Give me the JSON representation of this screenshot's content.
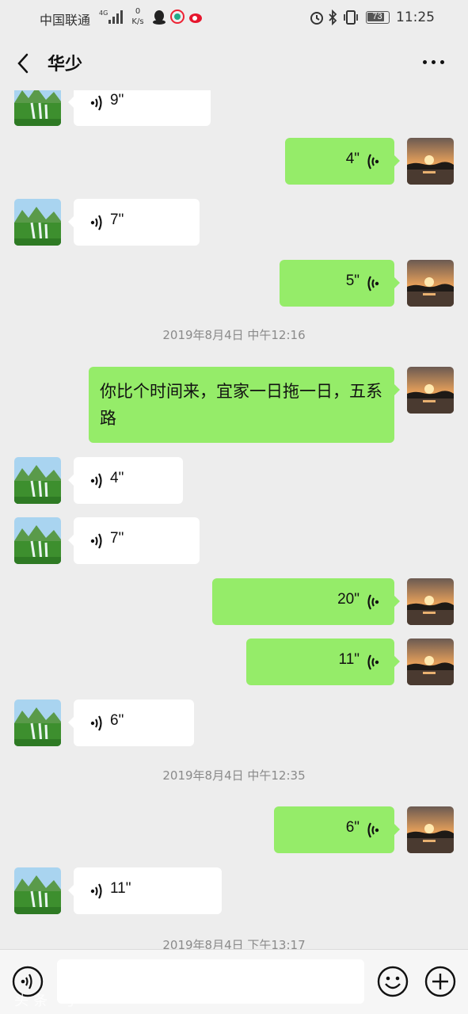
{
  "status_bar": {
    "carrier": "中国联通",
    "network": "4G",
    "speed_value": "0",
    "speed_unit": "K/s",
    "battery": "73",
    "time": "11:25"
  },
  "header": {
    "title": "华少"
  },
  "messages": [
    {
      "side": "in",
      "duration": "9\""
    },
    {
      "side": "out",
      "duration": "4\""
    },
    {
      "side": "in",
      "duration": "7\""
    },
    {
      "side": "out",
      "duration": "5\""
    },
    {
      "timestamp": "2019年8月4日 中午12:16"
    },
    {
      "side": "out",
      "text": "你比个时间来，宜家一日拖一日，五系路"
    },
    {
      "side": "in",
      "duration": "4\""
    },
    {
      "side": "in",
      "duration": "7\""
    },
    {
      "side": "out",
      "duration": "20\""
    },
    {
      "side": "out",
      "duration": "11\""
    },
    {
      "side": "in",
      "duration": "6\""
    },
    {
      "timestamp": "2019年8月4日 中午12:35"
    },
    {
      "side": "out",
      "duration": "6\""
    },
    {
      "side": "in",
      "duration": "11\""
    },
    {
      "timestamp": "2019年8月4日 下午13:17"
    }
  ],
  "input_bar": {
    "message_value": "",
    "watermark": "头条 号"
  },
  "colors": {
    "background": "#ededed",
    "outgoing_bubble": "#95ec69",
    "incoming_bubble": "#ffffff",
    "timestamp_text": "#8a8a8a"
  }
}
